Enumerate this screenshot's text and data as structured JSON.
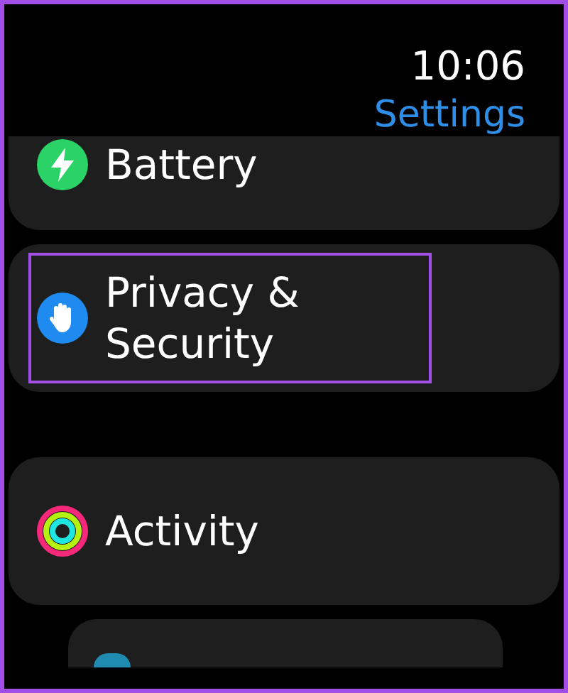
{
  "status": {
    "time": "10:06"
  },
  "header": {
    "title": "Settings"
  },
  "items": [
    {
      "label": "Battery",
      "kind": "battery",
      "highlighted": false
    },
    {
      "label": "Privacy & Security",
      "kind": "privacy",
      "highlighted": true
    },
    {
      "label": "Activity",
      "kind": "activity",
      "highlighted": false
    }
  ]
}
